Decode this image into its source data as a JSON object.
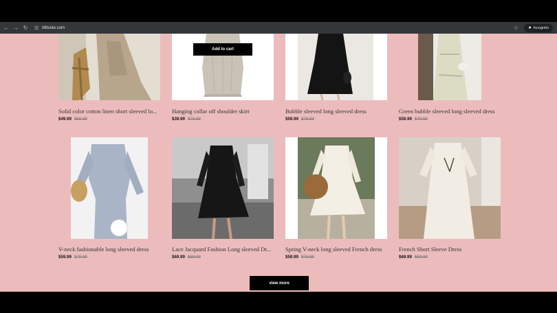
{
  "browser": {
    "url": "bfduste.com",
    "incognito_label": "Incognito"
  },
  "overlay": {
    "add_to_cart_label": "Add to cart"
  },
  "products": [
    {
      "title": "Solid color cotton linen short sleeved lo...",
      "price": "$49.99",
      "old_price": "$69.99"
    },
    {
      "title": "Hanging collar off shoulder skirt",
      "price": "$39.99",
      "old_price": "$79.99"
    },
    {
      "title": "Bubble sleeved long sleeved dress",
      "price": "$59.99",
      "old_price": "$79.99"
    },
    {
      "title": "Green bubble sleeved long sleeved dress",
      "price": "$59.99",
      "old_price": "$79.99"
    },
    {
      "title": "V-neck fashionable long sleeved dress",
      "price": "$59.99",
      "old_price": "$79.99"
    },
    {
      "title": "Lace Jacquard Fashion Long sleeved Dr...",
      "price": "$69.99",
      "old_price": "$89.99"
    },
    {
      "title": "Spring V-neck long sleeved French dress",
      "price": "$59.99",
      "old_price": "$79.99"
    },
    {
      "title": "French Short Sleeve Dress",
      "price": "$69.99",
      "old_price": "$89.99"
    }
  ],
  "view_more_label": "view more",
  "icons": {
    "back": "arrow-left-icon",
    "forward": "arrow-right-icon",
    "reload": "reload-icon",
    "site_settings": "tune-icon",
    "bookmark": "star-icon",
    "incognito": "incognito-icon"
  },
  "colors": {
    "page_bg": "#ecbcbc",
    "button_bg": "#000000",
    "chrome_bg": "#35363a"
  }
}
